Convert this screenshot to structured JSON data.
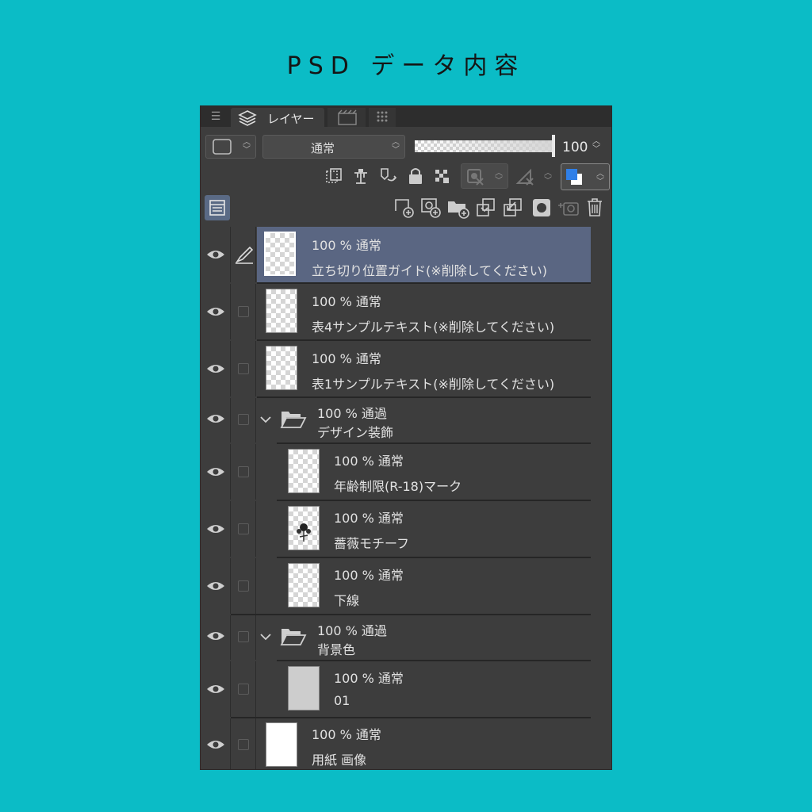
{
  "page": {
    "title": "PSD データ内容"
  },
  "tabs": {
    "layer_label": "レイヤー"
  },
  "toolbar": {
    "blend_mode": "通常",
    "opacity": "100"
  },
  "colors": {
    "selected_row": "#5a6682",
    "background": "#0bbcc6",
    "panel": "#3d3d3d"
  },
  "layers": [
    {
      "meta": "100 % 通常",
      "name": "立ち切り位置ガイド(※削除してください)",
      "selected": true,
      "icon": "pen-icon"
    },
    {
      "meta": "100 % 通常",
      "name": "表4サンプルテキスト(※削除してください)"
    },
    {
      "meta": "100 % 通常",
      "name": "表1サンプルテキスト(※削除してください)"
    },
    {
      "meta": "100 % 通過",
      "name": "デザイン装飾",
      "folder": true
    },
    {
      "meta": "100 % 通常",
      "name": "年齢制限(R-18)マーク"
    },
    {
      "meta": "100 % 通常",
      "name": "薔薇モチーフ"
    },
    {
      "meta": "100 % 通常",
      "name": "下線"
    },
    {
      "meta": "100 % 通過",
      "name": "背景色",
      "folder": true
    },
    {
      "meta": "100 % 通常",
      "name": "01"
    },
    {
      "meta": "100 % 通常",
      "name": "用紙 画像"
    }
  ]
}
